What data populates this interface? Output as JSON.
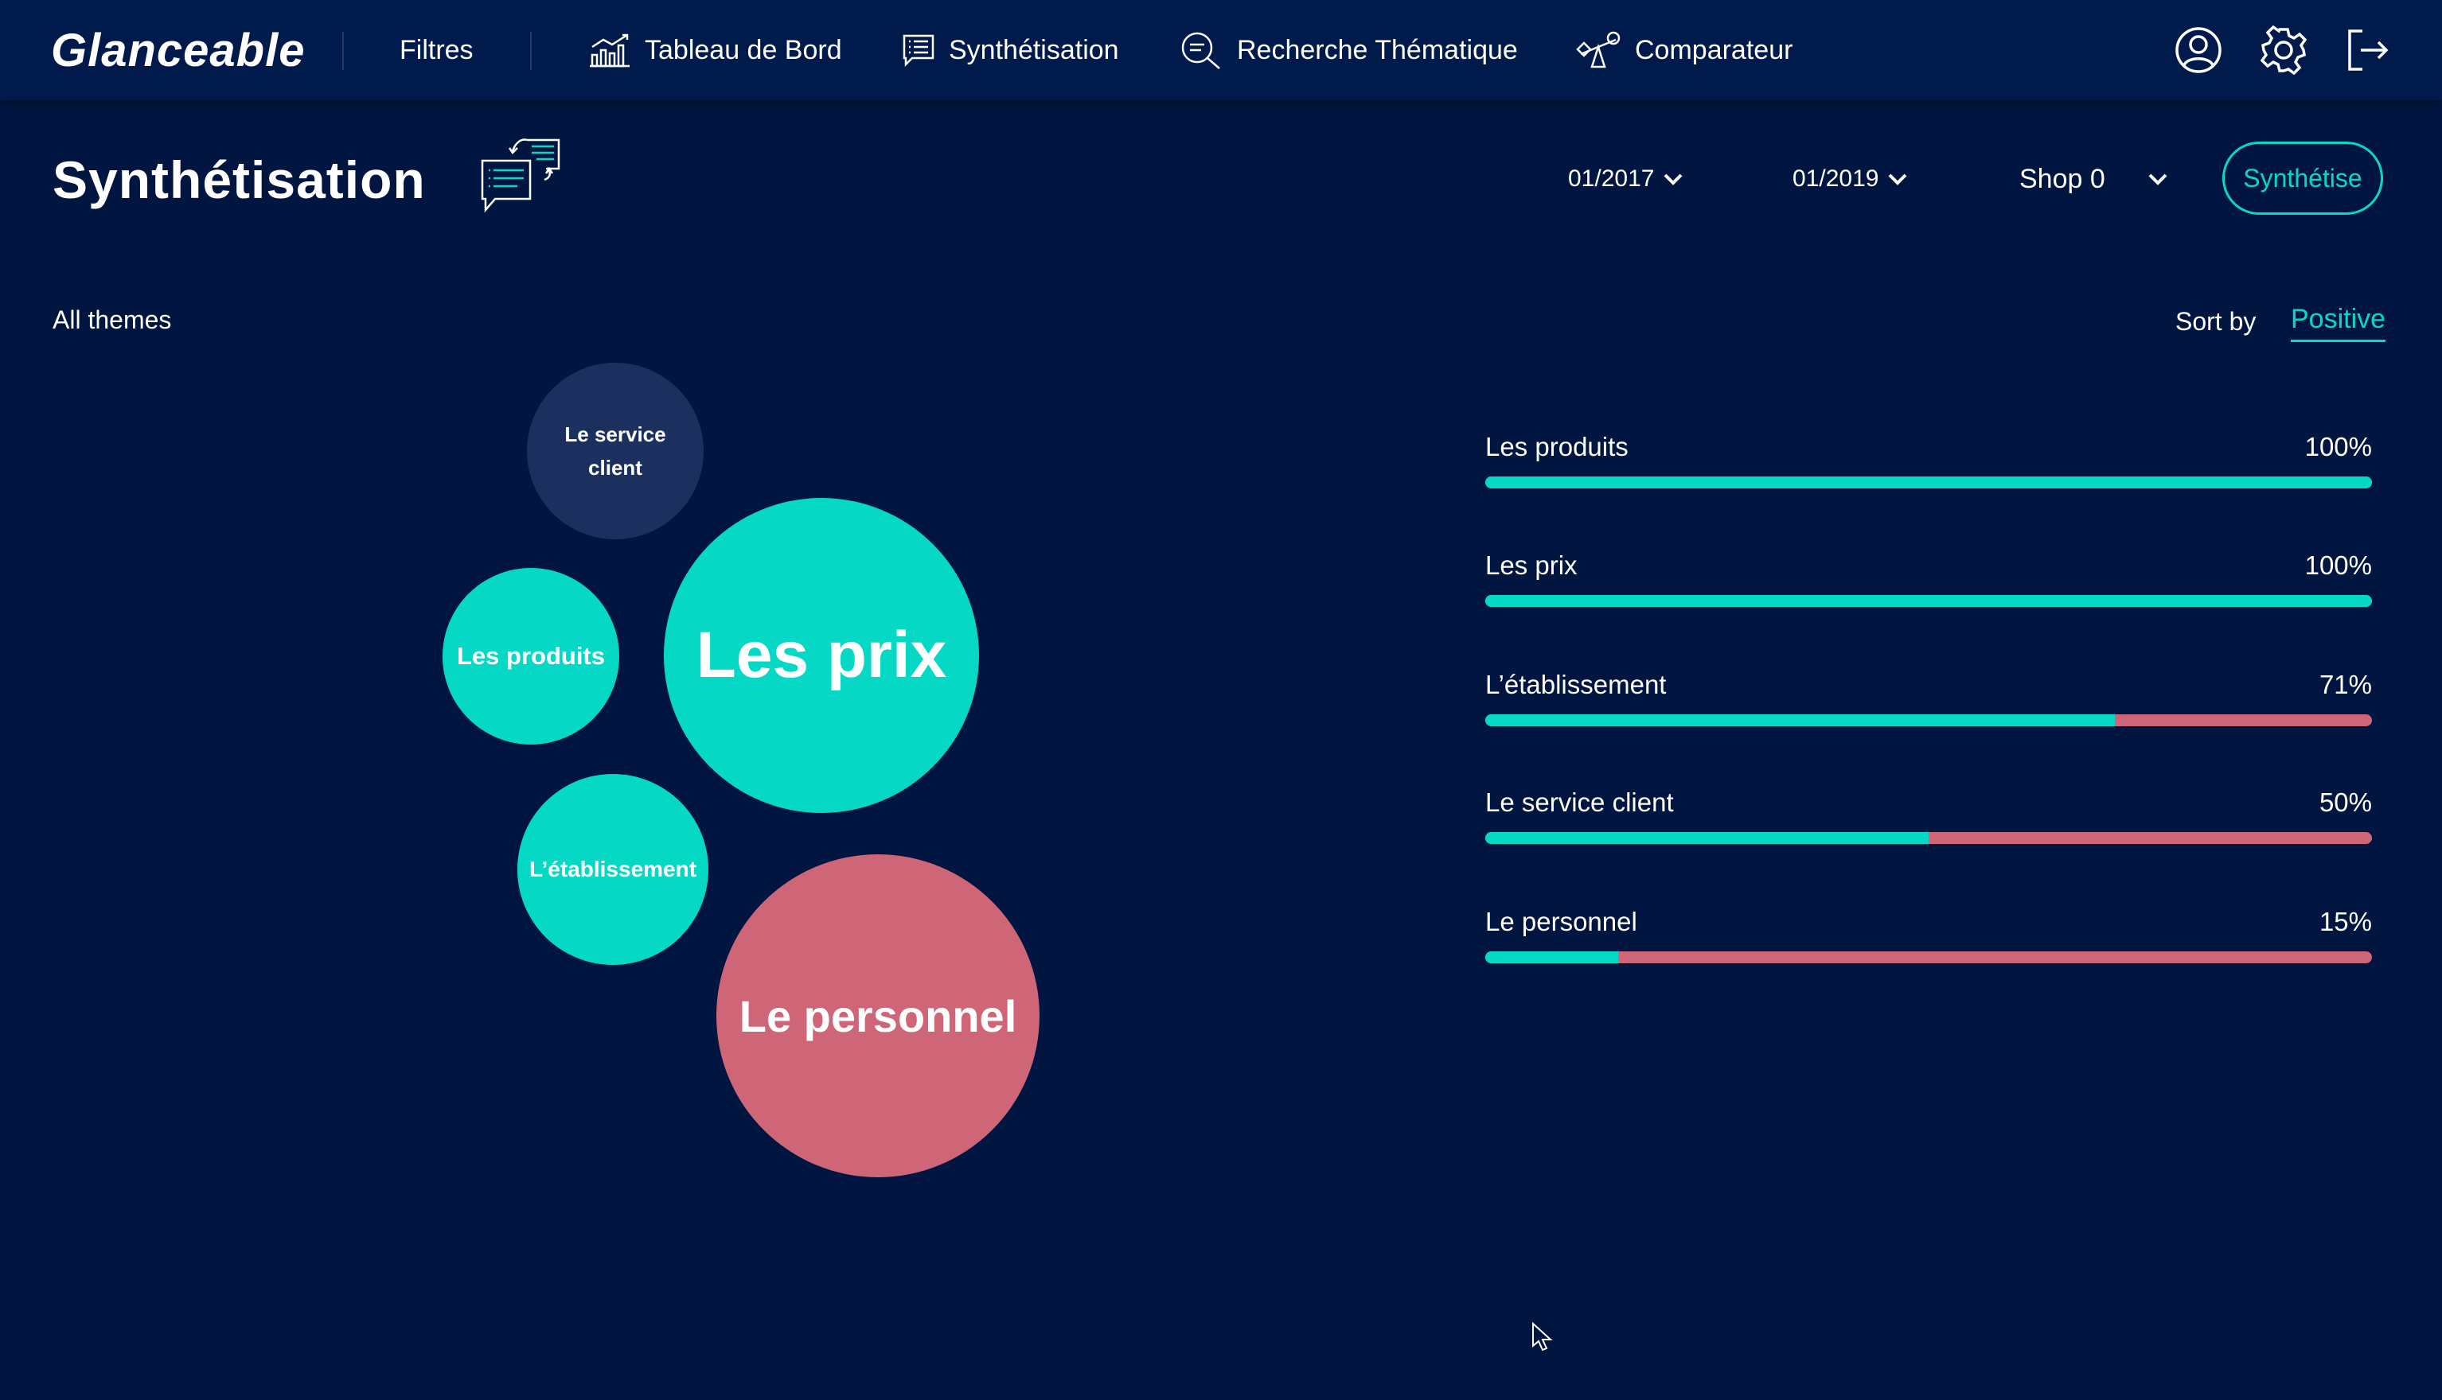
{
  "nav": {
    "logo": "Glanceable",
    "filters_label": "Filtres",
    "items": [
      {
        "label": "Tableau de Bord",
        "icon": "bar-chart-icon"
      },
      {
        "label": "Synthétisation",
        "icon": "document-list-icon"
      },
      {
        "label": "Recherche Thématique",
        "icon": "magnifier-icon"
      },
      {
        "label": "Comparateur",
        "icon": "balance-scale-icon"
      }
    ],
    "right_icons": [
      "user-account-icon",
      "settings-gear-icon",
      "logout-icon"
    ]
  },
  "header": {
    "title": "Synthétisation",
    "title_icon": "chat-document-icon",
    "date_from": "01/2017",
    "date_to": "01/2019",
    "shop": "Shop 0",
    "action_button": "Synthétise"
  },
  "themes": {
    "section_title": "All themes",
    "sort_label": "Sort by",
    "sort_value": "Positive"
  },
  "colors": {
    "background": "#001640",
    "navbar": "#011a4c",
    "positive": "#05d9c6",
    "negative": "#cf6677",
    "neutral": "#1b305f"
  },
  "bubbles": [
    {
      "label": "Le service client",
      "sentiment": "neutral"
    },
    {
      "label": "Les produits",
      "sentiment": "positive"
    },
    {
      "label": "Les prix",
      "sentiment": "positive"
    },
    {
      "label": "L’établissement",
      "sentiment": "positive"
    },
    {
      "label": "Le personnel",
      "sentiment": "negative"
    }
  ],
  "bars": [
    {
      "label": "Les produits",
      "percent_text": "100%",
      "positive": 1.0
    },
    {
      "label": "Les prix",
      "percent_text": "100%",
      "positive": 1.0
    },
    {
      "label": "L’établissement",
      "percent_text": "71%",
      "positive": 0.71
    },
    {
      "label": "Le service client",
      "percent_text": "50%",
      "positive": 0.5
    },
    {
      "label": "Le personnel",
      "percent_text": "15%",
      "positive": 0.15
    }
  ]
}
